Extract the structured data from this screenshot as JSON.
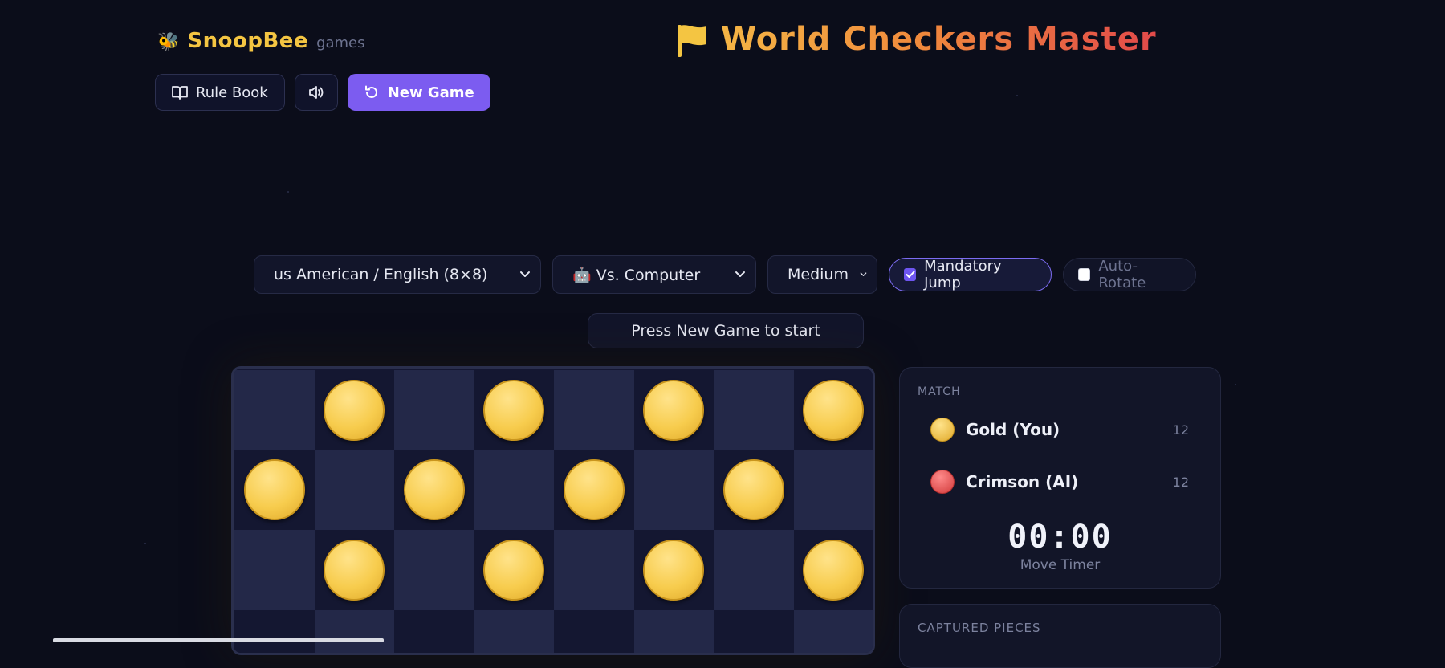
{
  "brand": {
    "emoji": "🐝",
    "name": "SnoopBee",
    "sub": "games"
  },
  "title": {
    "text": "World Checkers Master"
  },
  "toolbar": {
    "rulebook_label": "Rule Book",
    "new_game_label": "New Game"
  },
  "controls": {
    "variant": "us American / English (8×8)",
    "opponent_emoji": "🤖",
    "opponent": "Vs. Computer",
    "difficulty": "Medium",
    "mandatory_jump": {
      "label": "Mandatory Jump",
      "checked": true
    },
    "auto_rotate": {
      "label": "Auto-Rotate",
      "checked": false
    }
  },
  "status": "Press New Game to start",
  "board": {
    "size": 8,
    "visible_rows": 4,
    "pieces": [
      {
        "row": 0,
        "col": 1,
        "color": "gold"
      },
      {
        "row": 0,
        "col": 3,
        "color": "gold"
      },
      {
        "row": 0,
        "col": 5,
        "color": "gold"
      },
      {
        "row": 0,
        "col": 7,
        "color": "gold"
      },
      {
        "row": 1,
        "col": 0,
        "color": "gold"
      },
      {
        "row": 1,
        "col": 2,
        "color": "gold"
      },
      {
        "row": 1,
        "col": 4,
        "color": "gold"
      },
      {
        "row": 1,
        "col": 6,
        "color": "gold"
      },
      {
        "row": 2,
        "col": 1,
        "color": "gold"
      },
      {
        "row": 2,
        "col": 3,
        "color": "gold"
      },
      {
        "row": 2,
        "col": 5,
        "color": "gold"
      },
      {
        "row": 2,
        "col": 7,
        "color": "gold"
      }
    ]
  },
  "match": {
    "label": "MATCH",
    "players": [
      {
        "name": "Gold (You)",
        "count": "12",
        "color": "gold"
      },
      {
        "name": "Crimson (AI)",
        "count": "12",
        "color": "red"
      }
    ],
    "timer": "00:00",
    "timer_label": "Move Timer"
  },
  "captured": {
    "label": "CAPTURED PIECES"
  },
  "colors": {
    "accent": "#7c5cf0",
    "gold": "#f4c542",
    "crimson": "#d23c3c",
    "background": "#0b0d1a"
  }
}
